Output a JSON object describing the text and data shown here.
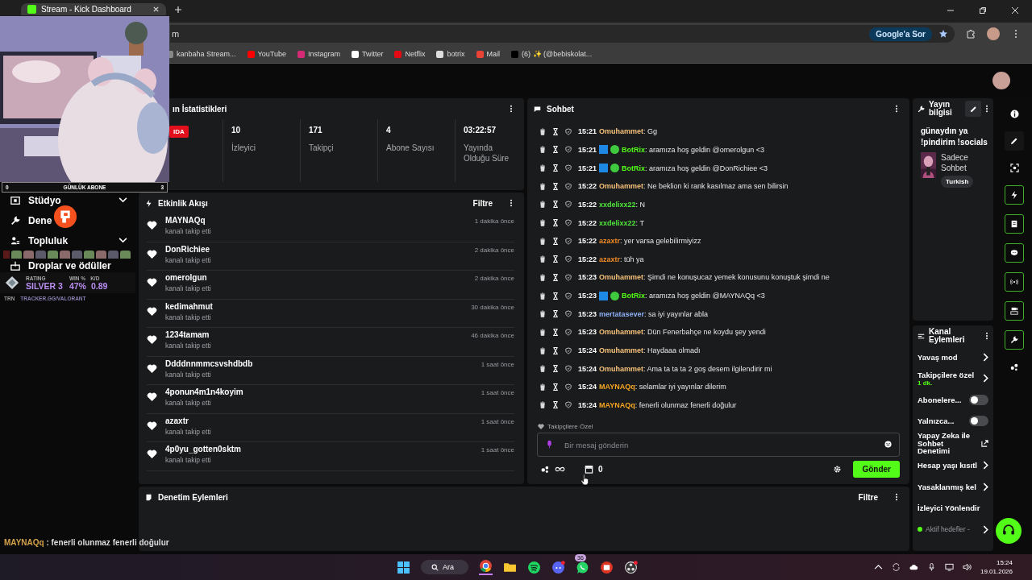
{
  "browser": {
    "tab_title": "Stream - Kick Dashboard",
    "address": "m",
    "ask_google": "Google'a Sor",
    "bookmarks": [
      {
        "label": "kanbaha Stream..."
      },
      {
        "label": "YouTube"
      },
      {
        "label": "Instagram"
      },
      {
        "label": "Twitter"
      },
      {
        "label": "Netflix"
      },
      {
        "label": "botrix"
      },
      {
        "label": "Mail"
      },
      {
        "label": "(6) ✨ (@bebiskolat..."
      }
    ]
  },
  "overlay": {
    "sub_goal": {
      "start": "0",
      "label": "GÜNLÜK ABONE",
      "end": "3"
    },
    "tracker": {
      "rating_label": "RATING",
      "rating": "SILVER 3",
      "win_label": "WIN %",
      "kd_label": "K/D",
      "win": "47%",
      "kd": "0.89",
      "brand": "TRN",
      "url": "TRACKER.GG/VALORANT"
    },
    "last_chat": {
      "user": "MAYNAQq",
      "text": " : fenerli olunmaz fenerli doğulur"
    }
  },
  "sidebar": {
    "items": [
      {
        "label": "Stüdyo",
        "expandable": true
      },
      {
        "label": "Dene",
        "expandable": false
      },
      {
        "label": "Topluluk",
        "expandable": true
      },
      {
        "label": "Droplar ve ödüller",
        "expandable": false
      }
    ]
  },
  "stats": {
    "title": "ın İstatistikleri",
    "live_badge": "IDA",
    "items": [
      {
        "value": "10",
        "label": "İzleyici"
      },
      {
        "value": "171",
        "label": "Takipçi"
      },
      {
        "value": "4",
        "label": "Abone Sayısı"
      },
      {
        "value": "03:22:57",
        "label": "Yayında Olduğu Süre"
      }
    ]
  },
  "events": {
    "title": "Etkinlik Akışı",
    "filter": "Filtre",
    "items": [
      {
        "user": "MAYNAQq",
        "action": "kanalı takip etti",
        "time": "1 dakika önce"
      },
      {
        "user": "DonRichiee",
        "action": "kanalı takip etti",
        "time": "2 dakika önce"
      },
      {
        "user": "omerolgun",
        "action": "kanalı takip etti",
        "time": "2 dakika önce"
      },
      {
        "user": "kedimahmut",
        "action": "kanalı takip etti",
        "time": "30 dakika önce"
      },
      {
        "user": "1234tamam",
        "action": "kanalı takip etti",
        "time": "46 dakika önce"
      },
      {
        "user": "Ddddnnmmcsvshdbdb",
        "action": "kanalı takip etti",
        "time": "1 saat önce"
      },
      {
        "user": "4ponun4m1n4koyim",
        "action": "kanalı takip etti",
        "time": "1 saat önce"
      },
      {
        "user": "azaxtr",
        "action": "kanalı takip etti",
        "time": "1 saat önce"
      },
      {
        "user": "4p0yu_gotten0sktm",
        "action": "kanalı takip etti",
        "time": "1 saat önce"
      }
    ]
  },
  "chat": {
    "title": "Sohbet",
    "messages": [
      {
        "time": "15:21",
        "user": "Omuhammet",
        "color": "#f5c27a",
        "bot_badges": false,
        "text": ": Gg"
      },
      {
        "time": "15:21",
        "user": "BotRix",
        "color": "#53fc18",
        "bot_badges": true,
        "text": ": aramıza hoş geldin @omerolgun <3"
      },
      {
        "time": "15:21",
        "user": "BotRix",
        "color": "#53fc18",
        "bot_badges": true,
        "text": ": aramıza hoş geldin @DonRichiee <3"
      },
      {
        "time": "15:22",
        "user": "Omuhammet",
        "color": "#f5c27a",
        "bot_badges": false,
        "text": ": Ne beklion ki rank kasılmaz ama sen bilirsin"
      },
      {
        "time": "15:22",
        "user": "xxdelixx22",
        "color": "#4fe33a",
        "bot_badges": false,
        "text": ": N"
      },
      {
        "time": "15:22",
        "user": "xxdelixx22",
        "color": "#4fe33a",
        "bot_badges": false,
        "text": ": T"
      },
      {
        "time": "15:22",
        "user": "azaxtr",
        "color": "#f08a24",
        "bot_badges": false,
        "text": ": yer varsa gelebilirmiyizz"
      },
      {
        "time": "15:22",
        "user": "azaxtr",
        "color": "#f08a24",
        "bot_badges": false,
        "text": ": tüh ya"
      },
      {
        "time": "15:23",
        "user": "Omuhammet",
        "color": "#f5c27a",
        "bot_badges": false,
        "text": ": Şimdi ne konuşucaz yemek konusunu konuştuk şimdi ne"
      },
      {
        "time": "15:23",
        "user": "BotRix",
        "color": "#53fc18",
        "bot_badges": true,
        "text": ": aramıza hoş geldin @MAYNAQq <3"
      },
      {
        "time": "15:23",
        "user": "mertatasever",
        "color": "#8fb0f5",
        "bot_badges": false,
        "text": ": sa iyi yayınlar abla"
      },
      {
        "time": "15:23",
        "user": "Omuhammet",
        "color": "#f5c27a",
        "bot_badges": false,
        "text": ": Dün Fenerbahçe ne koydu şey yendi"
      },
      {
        "time": "15:24",
        "user": "Omuhammet",
        "color": "#f5c27a",
        "bot_badges": false,
        "text": ": Haydaaa olmadı"
      },
      {
        "time": "15:24",
        "user": "Omuhammet",
        "color": "#f5c27a",
        "bot_badges": false,
        "text": ": Ama ta ta ta 2 goş desem ilgilendirir mi"
      },
      {
        "time": "15:24",
        "user": "MAYNAQq",
        "color": "#f5a623",
        "bot_badges": false,
        "text": ": selamlar iyi yayınlar dilerim"
      },
      {
        "time": "15:24",
        "user": "MAYNAQq",
        "color": "#f5a623",
        "bot_badges": false,
        "text": ": fenerli olunmaz fenerli doğulur"
      }
    ],
    "mode_label": "Takipçilere Özel",
    "placeholder": "Bir mesaj gönderin",
    "count": "0",
    "send": "Gönder"
  },
  "moderation": {
    "title": "Denetim Eylemleri",
    "filter": "Filtre"
  },
  "stream_info": {
    "title": "Yayın bilgisi",
    "stream_title": "günaydın ya !pindirim !socials",
    "category": "Sadece Sohbet",
    "tag": "Turkish"
  },
  "channel_actions": {
    "title": "Kanal Eylemleri",
    "items": [
      {
        "kind": "chevron",
        "label": "Yavaş mod"
      },
      {
        "kind": "chevron",
        "label": "Takipçilere özel",
        "sub": "1 dk."
      },
      {
        "kind": "toggle",
        "label": "Abonelere...",
        "on": false
      },
      {
        "kind": "toggle",
        "label": "Yalnızca...",
        "on": false
      },
      {
        "kind": "external",
        "label": "Yapay Zeka ile Sohbet Denetimi"
      },
      {
        "kind": "chevron",
        "label": "Hesap yaşı kısıtl"
      },
      {
        "kind": "chevron",
        "label": "Yasaklanmış kel"
      },
      {
        "kind": "plain",
        "label": "İzleyici Yönlendir"
      },
      {
        "kind": "status",
        "label": "Aktif hedefler -"
      }
    ]
  },
  "taskbar": {
    "search": "Ara",
    "whatsapp_badge": "36",
    "time": "15:24",
    "date": "19.01.2026"
  }
}
